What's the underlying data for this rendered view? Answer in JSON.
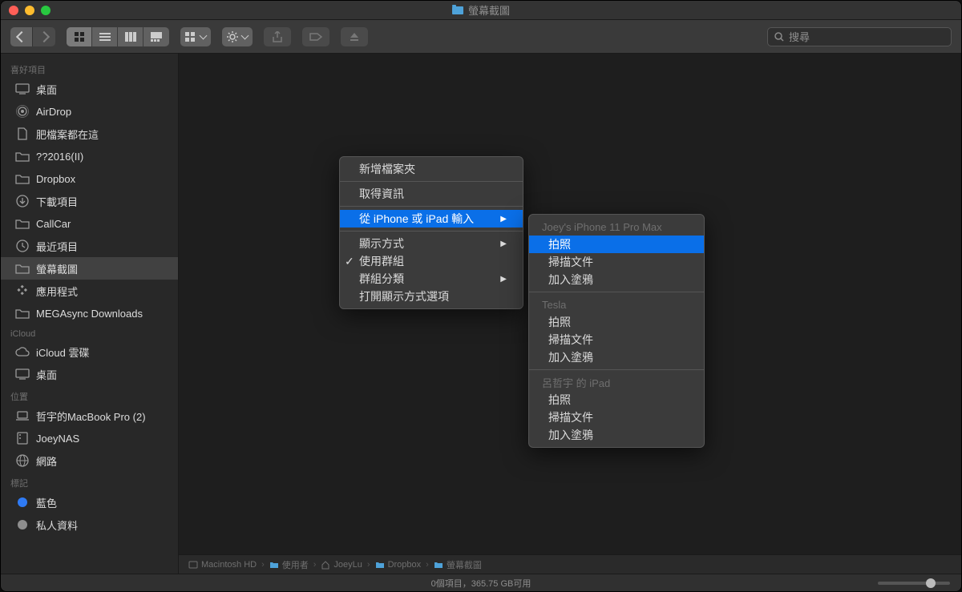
{
  "window": {
    "title": "螢幕截圖"
  },
  "toolbar": {
    "search_placeholder": "搜尋"
  },
  "sidebar": {
    "sections": [
      {
        "title": "喜好項目",
        "items": [
          {
            "label": "桌面",
            "icon": "desktop"
          },
          {
            "label": "AirDrop",
            "icon": "airdrop"
          },
          {
            "label": "肥檔案都在這",
            "icon": "doc"
          },
          {
            "label": "??2016(II)",
            "icon": "folder"
          },
          {
            "label": "Dropbox",
            "icon": "folder"
          },
          {
            "label": "下載項目",
            "icon": "download"
          },
          {
            "label": "CallCar",
            "icon": "folder"
          },
          {
            "label": "最近項目",
            "icon": "clock"
          },
          {
            "label": "螢幕截圖",
            "icon": "folder",
            "selected": true
          },
          {
            "label": "應用程式",
            "icon": "apps"
          },
          {
            "label": "MEGAsync Downloads",
            "icon": "folder"
          }
        ]
      },
      {
        "title": "iCloud",
        "items": [
          {
            "label": "iCloud 雲碟",
            "icon": "cloud"
          },
          {
            "label": "桌面",
            "icon": "desktop"
          }
        ]
      },
      {
        "title": "位置",
        "items": [
          {
            "label": "哲宇的MacBook Pro (2)",
            "icon": "laptop"
          },
          {
            "label": "JoeyNAS",
            "icon": "server"
          },
          {
            "label": "網路",
            "icon": "globe"
          }
        ]
      },
      {
        "title": "標記",
        "items": [
          {
            "label": "藍色",
            "icon": "tag-blue"
          },
          {
            "label": "私人資料",
            "icon": "tag-gray"
          }
        ]
      }
    ]
  },
  "context_menu": {
    "items": [
      {
        "label": "新增檔案夾"
      },
      {
        "sep": true
      },
      {
        "label": "取得資訊"
      },
      {
        "sep": true
      },
      {
        "label": "從 iPhone 或 iPad 輸入",
        "submenu": true,
        "highlighted": true
      },
      {
        "sep": true
      },
      {
        "label": "顯示方式",
        "submenu": true
      },
      {
        "label": "使用群組",
        "checked": true
      },
      {
        "label": "群組分類",
        "submenu": true
      },
      {
        "label": "打開顯示方式選項"
      }
    ]
  },
  "submenu": {
    "groups": [
      {
        "header": "Joey's iPhone 11 Pro Max",
        "items": [
          {
            "label": "拍照",
            "highlighted": true
          },
          {
            "label": "掃描文件"
          },
          {
            "label": "加入塗鴉"
          }
        ]
      },
      {
        "header": "Tesla",
        "items": [
          {
            "label": "拍照"
          },
          {
            "label": "掃描文件"
          },
          {
            "label": "加入塗鴉"
          }
        ]
      },
      {
        "header": "呂哲宇 的 iPad",
        "items": [
          {
            "label": "拍照"
          },
          {
            "label": "掃描文件"
          },
          {
            "label": "加入塗鴉"
          }
        ]
      }
    ]
  },
  "pathbar": {
    "crumbs": [
      {
        "label": "Macintosh HD",
        "icon": "disk"
      },
      {
        "label": "使用者",
        "icon": "folder"
      },
      {
        "label": "JoeyLu",
        "icon": "home"
      },
      {
        "label": "Dropbox",
        "icon": "folder"
      },
      {
        "label": "螢幕截圖",
        "icon": "folder"
      }
    ]
  },
  "statusbar": {
    "text": "0個項目，365.75 GB可用"
  }
}
